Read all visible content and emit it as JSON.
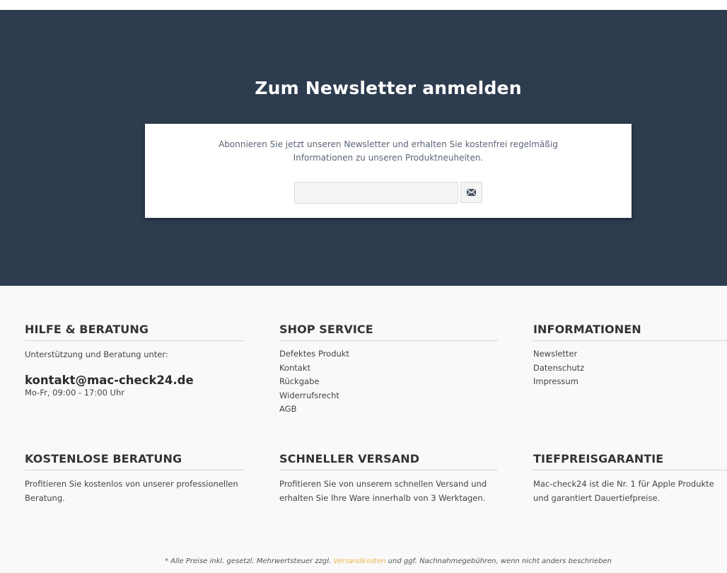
{
  "newsletter": {
    "title": "Zum Newsletter anmelden",
    "text_line1": "Abonnieren Sie jetzt unseren Newsletter und erhalten Sie kostenfrei regelmäßig",
    "text_line2": "Informationen zu unseren Produktneuheiten.",
    "email_value": "",
    "email_placeholder": "",
    "submit_icon": "envelope-icon"
  },
  "footer": {
    "hilfe": {
      "heading": "Hilfe & Beratung",
      "intro": "Unterstützung und Beratung unter:",
      "email": "kontakt@mac-check24.de",
      "hours": "Mo-Fr, 09:00 - 17:00 Uhr"
    },
    "shop_service": {
      "heading": "Shop Service",
      "links": [
        "Defektes Produkt",
        "Kontakt",
        "Rückgabe",
        "Widerrufsrecht",
        "AGB"
      ]
    },
    "informationen": {
      "heading": "Informationen",
      "links": [
        "Newsletter",
        "Datenschutz",
        "Impressum"
      ]
    },
    "beratung": {
      "heading": "Kostenlose Beratung",
      "text": "Profitieren Sie kostenlos von unserer professionellen Beratung."
    },
    "versand": {
      "heading": "Schneller Versand",
      "text": "Profitieren Sie von unserem schnellen Versand und erhalten Sie Ihre Ware innerhalb von 3 Werktagen."
    },
    "tiefpreis": {
      "heading": "Tiefpreisgarantie",
      "text": "Mac-check24 ist die Nr. 1 für Apple Produkte und garantiert Dauertiefpreise."
    },
    "disclaimer": {
      "before": "* Alle Preise inkl. gesetzl. Mehrwertsteuer zzgl.",
      "link": "Versandkosten",
      "after": "und ggf. Nachnahmegebühren, wenn nicht anders beschrieben"
    }
  },
  "colors": {
    "band": "#2d3c4e",
    "accent_link": "#e8b84a",
    "footer_bg": "#f9f9f9"
  }
}
